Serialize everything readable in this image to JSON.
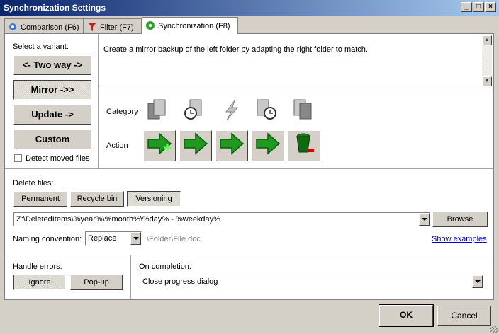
{
  "window": {
    "title": "Synchronization Settings"
  },
  "tabs": [
    {
      "label": "Comparison (F6)",
      "icon": "gear-icon"
    },
    {
      "label": "Filter (F7)",
      "icon": "filter-icon"
    },
    {
      "label": "Synchronization (F8)",
      "icon": "sync-gear-icon",
      "active": true
    }
  ],
  "variant": {
    "heading": "Select a variant:",
    "options": [
      "<- Two way ->",
      "Mirror ->>",
      "Update ->",
      "Custom"
    ],
    "selected": "Mirror ->>",
    "detect_moved_label": "Detect moved files",
    "detect_moved_checked": false
  },
  "description": "Create a mirror backup of the left folder by adapting the right folder to match.",
  "category": {
    "label": "Category",
    "icons": [
      "left-only-file-icon",
      "left-newer-file-icon",
      "conflict-icon",
      "right-newer-file-icon",
      "right-only-file-icon"
    ]
  },
  "action": {
    "label": "Action",
    "buttons": [
      "create-right-icon",
      "copy-right-icon",
      "copy-right-icon",
      "copy-right-icon",
      "delete-right-icon"
    ]
  },
  "delete_files": {
    "label": "Delete files:",
    "options": [
      "Permanent",
      "Recycle bin",
      "Versioning"
    ],
    "selected": "Versioning",
    "path_value": "Z:\\DeletedItems\\%year%\\%month%\\%day% - %weekday%",
    "browse_label": "Browse",
    "naming_label": "Naming convention:",
    "naming_value": "Replace",
    "naming_example": "\\Folder\\File.doc",
    "show_examples": "Show examples"
  },
  "errors": {
    "label": "Handle errors:",
    "options": [
      "Ignore",
      "Pop-up"
    ],
    "selected": "Ignore"
  },
  "completion": {
    "label": "On completion:",
    "value": "Close progress dialog"
  },
  "footer": {
    "ok_label": "OK",
    "cancel_label": "Cancel"
  },
  "colors": {
    "accent_green": "#1f9a1f",
    "title_bar": "#0a246a",
    "delete_red": "#d40000"
  }
}
